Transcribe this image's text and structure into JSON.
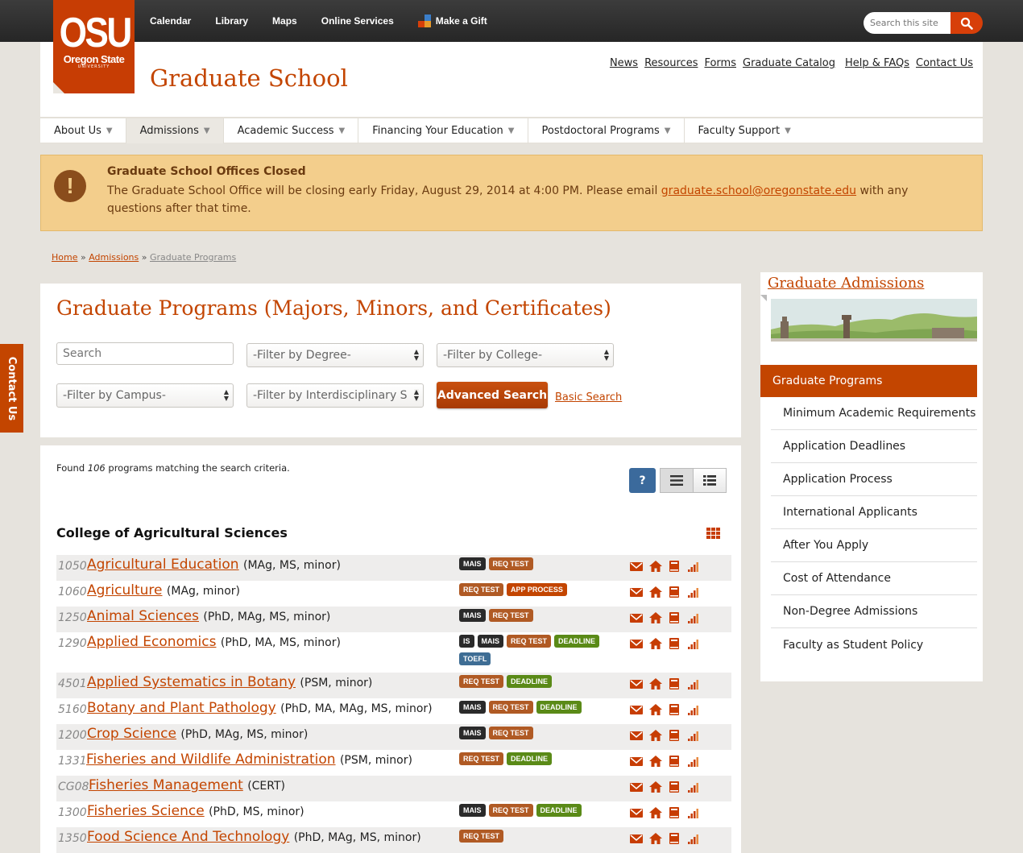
{
  "topnav": {
    "links": [
      "Calendar",
      "Library",
      "Maps",
      "Online Services"
    ],
    "gift_label": "Make a Gift",
    "search_placeholder": "Search this site"
  },
  "logo": {
    "line1": "OSU",
    "line2": "Oregon State",
    "line3": "UNIVERSITY"
  },
  "header": {
    "title": "Graduate School",
    "util_links": [
      "News",
      "Resources",
      "Forms",
      "Graduate Catalog",
      "Help & FAQs",
      "Contact Us"
    ]
  },
  "nav": {
    "items": [
      "About Us",
      "Admissions",
      "Academic Success",
      "Financing Your Education",
      "Postdoctoral Programs",
      "Faculty Support"
    ],
    "active": "Admissions"
  },
  "alert": {
    "title": "Graduate School Offices Closed",
    "body_before": "The Graduate School Office will be closing early Friday, August 29, 2014 at 4:00 PM.  Please email ",
    "email": "graduate.school@oregonstate.edu",
    "body_after": " with any questions after that time."
  },
  "breadcrumb": {
    "home": "Home",
    "admissions": "Admissions",
    "current": "Graduate Programs"
  },
  "search": {
    "title": "Graduate Programs (Majors, Minors, and Certificates)",
    "search_placeholder": "Search",
    "degree": "-Filter by Degree-",
    "college": "-Filter by College-",
    "campus": "-Filter by Campus-",
    "interdisciplinary": "-Filter by Interdisciplinary S",
    "advanced_label": "Advanced Search",
    "basic_label": "Basic Search"
  },
  "results": {
    "found_prefix": "Found ",
    "count": "106",
    "found_suffix": " programs matching the search criteria.",
    "help_label": "?",
    "college": "College of Agricultural Sciences",
    "programs": [
      {
        "code": "1050",
        "name": "Agricultural Education",
        "degrees": "(MAg, MS, minor)",
        "tags": [
          "MAIS",
          "REQ TEST"
        ]
      },
      {
        "code": "1060",
        "name": "Agriculture",
        "degrees": "(MAg, minor)",
        "tags": [
          "REQ TEST",
          "APP PROCESS"
        ]
      },
      {
        "code": "1250",
        "name": "Animal Sciences",
        "degrees": "(PhD, MAg, MS, minor)",
        "tags": [
          "MAIS",
          "REQ TEST"
        ]
      },
      {
        "code": "1290",
        "name": "Applied Economics",
        "degrees": "(PhD, MA, MS, minor)",
        "tags": [
          "IS",
          "MAIS",
          "REQ TEST",
          "DEADLINE",
          "TOEFL"
        ]
      },
      {
        "code": "4501",
        "name": "Applied Systematics in Botany",
        "degrees": "(PSM, minor)",
        "tags": [
          "REQ TEST",
          "DEADLINE"
        ]
      },
      {
        "code": "5160",
        "name": "Botany and Plant Pathology",
        "degrees": "(PhD, MA, MAg, MS, minor)",
        "tags": [
          "MAIS",
          "REQ TEST",
          "DEADLINE"
        ]
      },
      {
        "code": "1200",
        "name": "Crop Science",
        "degrees": "(PhD, MAg, MS, minor)",
        "tags": [
          "MAIS",
          "REQ TEST"
        ]
      },
      {
        "code": "1331",
        "name": "Fisheries and Wildlife Administration",
        "degrees": "(PSM, minor)",
        "tags": [
          "REQ TEST",
          "DEADLINE"
        ]
      },
      {
        "code": "CG08",
        "name": "Fisheries Management",
        "degrees": "(CERT)",
        "tags": []
      },
      {
        "code": "1300",
        "name": "Fisheries Science",
        "degrees": "(PhD, MS, minor)",
        "tags": [
          "MAIS",
          "REQ TEST",
          "DEADLINE"
        ]
      },
      {
        "code": "1350",
        "name": "Food Science And Technology",
        "degrees": "(PhD, MAg, MS, minor)",
        "tags": [
          "REQ TEST"
        ]
      }
    ]
  },
  "sidebar": {
    "title": "Graduate Admissions",
    "active": "Graduate Programs",
    "items": [
      "Minimum Academic Requirements",
      "Application Deadlines",
      "Application Process",
      "International Applicants",
      "After You Apply",
      "Cost of Attendance",
      "Non-Degree Admissions",
      "Faculty as Student Policy"
    ]
  },
  "contact_tab": "Contact Us",
  "colors": {
    "brand": "#c34500",
    "alert": "#f3ce8c",
    "deadline": "#5a8a17",
    "toefl": "#3e6d94"
  }
}
